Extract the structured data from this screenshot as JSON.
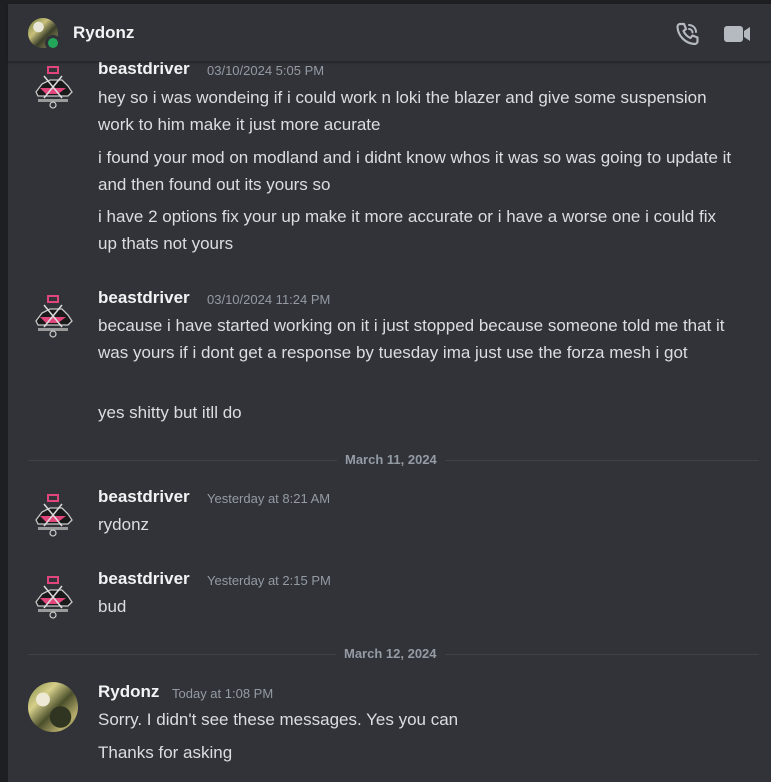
{
  "header": {
    "name": "Rydonz",
    "status_color": "#23a55a",
    "call_icon": "phone-call-icon",
    "video_icon": "video-camera-icon"
  },
  "messages": [
    {
      "author": "beastdriver",
      "timestamp": "03/10/2024 5:05 PM",
      "lines": [
        "hey so i was wondeing if i could work n loki the blazer and give some suspension work to him make it just more acurate",
        "i found your mod on modland and i didnt know whos it was so was going to update it and then found out its yours so",
        "i have 2 options fix your up make it more accurate or i have a worse one i could fix up thats not yours"
      ]
    },
    {
      "author": "beastdriver",
      "timestamp": "03/10/2024 11:24 PM",
      "lines": [
        "because i have started working on it i just stopped because someone told me that it was yours if i dont get a response by tuesday ima just use the forza mesh i got",
        "yes shitty but itll do"
      ]
    },
    {
      "author": "beastdriver",
      "timestamp": "Yesterday at 8:21 AM",
      "lines": [
        "rydonz"
      ]
    },
    {
      "author": "beastdriver",
      "timestamp": "Yesterday at 2:15 PM",
      "lines": [
        "bud"
      ]
    },
    {
      "author": "Rydonz",
      "timestamp": "Today at 1:08 PM",
      "lines": [
        "Sorry. I didn't see these messages. Yes you can",
        "Thanks for asking"
      ]
    }
  ],
  "dividers": [
    "March 11, 2024",
    "March 12, 2024"
  ],
  "colors": {
    "background": "#313338",
    "text": "#dbdee1",
    "muted": "#949ba4",
    "avatar_accent": "#e0457b"
  }
}
